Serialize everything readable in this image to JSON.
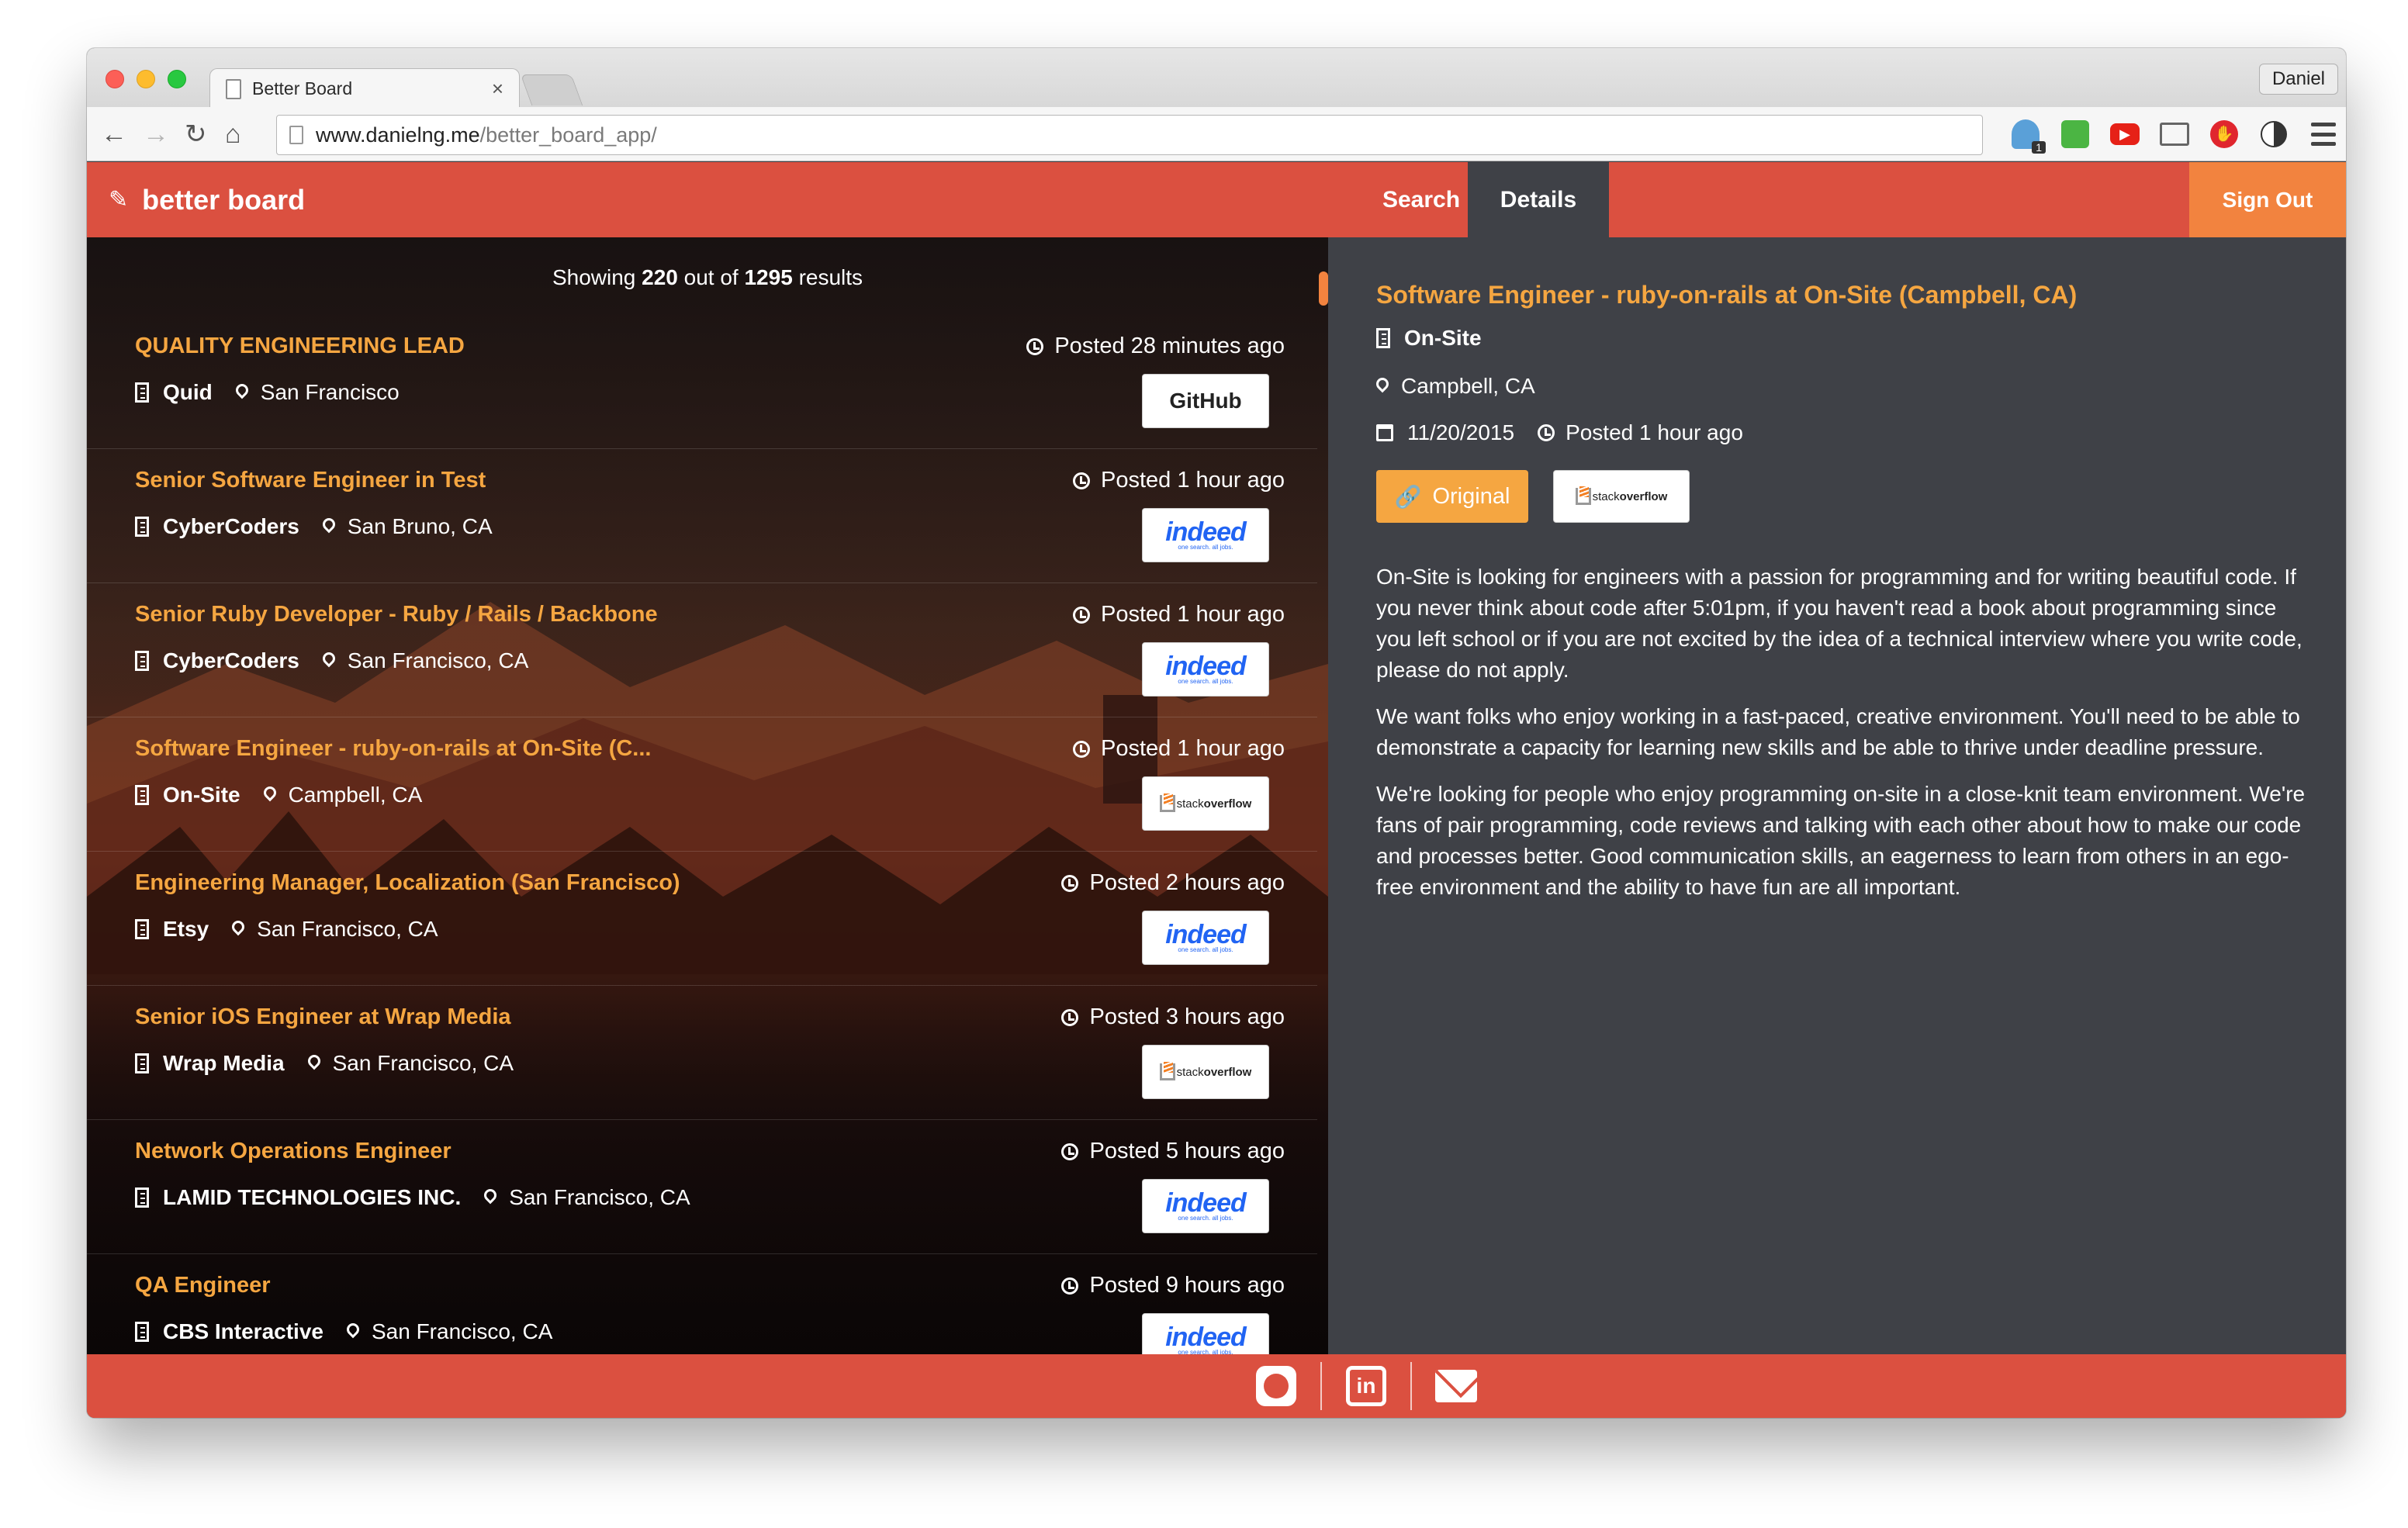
{
  "browser": {
    "tab_title": "Better Board",
    "tab_close": "×",
    "profile": "Daniel",
    "url_host": "www.danielng.me",
    "url_path": "/better_board_app/",
    "nav": {
      "back": "←",
      "forward": "→",
      "reload": "↻",
      "home": "⌂"
    },
    "extension_badge": "1"
  },
  "app": {
    "brand": "better board",
    "brand_icon": "pushpin-icon",
    "nav": {
      "search": "Search",
      "details": "Details",
      "sign_out": "Sign Out"
    },
    "active_nav": "details"
  },
  "results": {
    "prefix": "Showing",
    "shown": "220",
    "middle": "out of",
    "total": "1295",
    "suffix": "results"
  },
  "jobs": [
    {
      "title": "QUALITY ENGINEERING LEAD",
      "company": "Quid",
      "location": "San Francisco",
      "posted": "Posted 28 minutes ago",
      "source": "github",
      "source_label": "GitHub"
    },
    {
      "title": "Senior Software Engineer in Test",
      "company": "CyberCoders",
      "location": "San Bruno, CA",
      "posted": "Posted 1 hour ago",
      "source": "indeed",
      "source_label": "indeed"
    },
    {
      "title": "Senior Ruby Developer - Ruby / Rails / Backbone",
      "company": "CyberCoders",
      "location": "San Francisco, CA",
      "posted": "Posted 1 hour ago",
      "source": "indeed",
      "source_label": "indeed"
    },
    {
      "title": "Software Engineer - ruby-on-rails at On-Site (C...",
      "company": "On-Site",
      "location": "Campbell, CA",
      "posted": "Posted 1 hour ago",
      "source": "stackoverflow",
      "source_label": "stackoverflow"
    },
    {
      "title": "Engineering Manager, Localization (San Francisco)",
      "company": "Etsy",
      "location": "San Francisco, CA",
      "posted": "Posted 2 hours ago",
      "source": "indeed",
      "source_label": "indeed"
    },
    {
      "title": "Senior iOS Engineer at Wrap Media",
      "company": "Wrap Media",
      "location": "San Francisco, CA",
      "posted": "Posted 3 hours ago",
      "source": "stackoverflow",
      "source_label": "stackoverflow"
    },
    {
      "title": "Network Operations Engineer",
      "company": "LAMID TECHNOLOGIES INC.",
      "location": "San Francisco, CA",
      "posted": "Posted 5 hours ago",
      "source": "indeed",
      "source_label": "indeed"
    },
    {
      "title": "QA Engineer",
      "company": "CBS Interactive",
      "location": "San Francisco, CA",
      "posted": "Posted 9 hours ago",
      "source": "indeed",
      "source_label": "indeed"
    }
  ],
  "indeed_tagline": "one search. all jobs.",
  "so_wordmark": {
    "light": "stack",
    "bold": "overflow"
  },
  "detail": {
    "title": "Software Engineer - ruby-on-rails at On-Site (Campbell, CA)",
    "company": "On-Site",
    "location": "Campbell, CA",
    "date": "11/20/2015",
    "posted": "Posted 1 hour ago",
    "original_button": "Original",
    "source": "stackoverflow",
    "description": [
      "On-Site is looking for engineers with a passion for programming and for writing beautiful code. If you never think about code after 5:01pm, if you haven't read a book about programming since you left school or if you are not excited by the idea of a technical interview where you write code, please do not apply.",
      "We want folks who enjoy working in a fast-paced, creative environment. You'll need to be able to demonstrate a capacity for learning new skills and be able to thrive under deadline pressure.",
      "We're looking for people who enjoy programming on-site in a close-knit team environment. We're fans of pair programming, code reviews and talking with each other about how to make our code and processes better. Good communication skills, an eagerness to learn from others in an ego-free environment and the ability to have fun are all important."
    ]
  },
  "footer": {
    "icons": [
      "github-icon",
      "linkedin-icon",
      "email-icon"
    ],
    "linkedin_text": "in"
  },
  "colors": {
    "brand_red": "#db5040",
    "accent_orange": "#f5a641",
    "signout_orange": "#f2833f",
    "detail_bg": "#3f4147"
  }
}
